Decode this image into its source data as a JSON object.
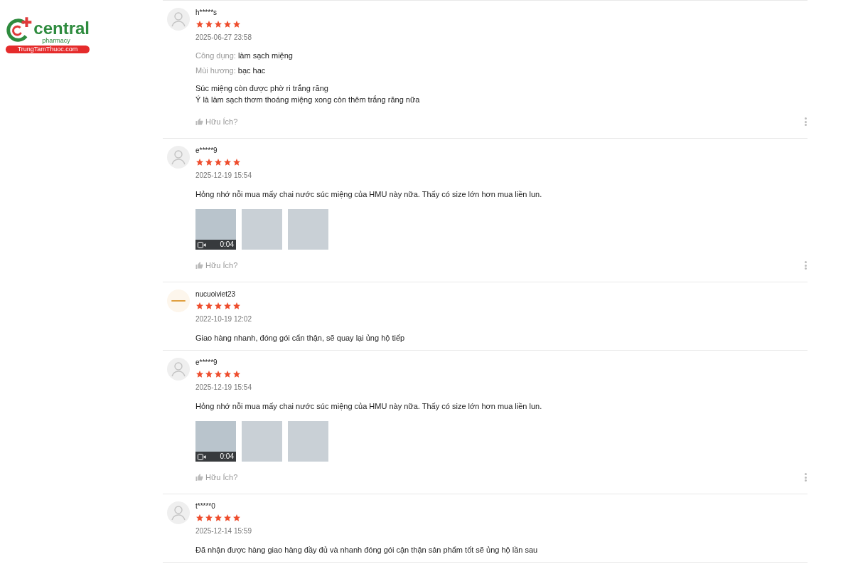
{
  "logo": {
    "name": "central",
    "tagline": "pharmacy",
    "site": "TrungTamThuoc.com"
  },
  "reviews": [
    {
      "avatar": {
        "kind": "default"
      },
      "username": "h*****s",
      "stars": 5,
      "date": "2025-06-27 23:58",
      "attributes": [
        {
          "label": "Công dụng:",
          "value": "làm sạch miệng"
        },
        {
          "label": "Mùi hương:",
          "value": "bạc hac"
        }
      ],
      "body": [
        "Súc miệng còn được phờ ri trắng răng",
        "Ý là làm sạch thơm thoáng miệng xong còn thêm trắng răng nữa"
      ],
      "helpful": "Hữu Ích?",
      "more_menu": true
    },
    {
      "avatar": {
        "kind": "default"
      },
      "username": "e*****9",
      "stars": 5,
      "date": "2025-12-19 15:54",
      "body": [
        "Hỏng nhớ nỗi mua mấy chai nước súc miệng của HMU này nữa. Thấy có size lớn hơn mua liền lun."
      ],
      "media": [
        {
          "kind": "video",
          "duration": "0:04"
        },
        {
          "kind": "photo"
        },
        {
          "kind": "photo"
        }
      ],
      "helpful": "Hữu Ích?",
      "more_menu": true
    },
    {
      "avatar": {
        "kind": "brand"
      },
      "username": "nucuoiviet23",
      "stars": 5,
      "date": "2022-10-19 12:02",
      "body": [
        "Giao hàng nhanh, đóng gói cẩn thận, sẽ quay lại ủng hộ tiếp"
      ],
      "more_menu": false
    },
    {
      "avatar": {
        "kind": "default"
      },
      "username": "e*****9",
      "stars": 5,
      "date": "2025-12-19 15:54",
      "body": [
        "Hỏng nhớ nỗi mua mấy chai nước súc miệng của HMU này nữa. Thấy có size lớn hơn mua liền lun."
      ],
      "media": [
        {
          "kind": "video",
          "duration": "0:04"
        },
        {
          "kind": "photo"
        },
        {
          "kind": "photo"
        }
      ],
      "helpful": "Hữu Ích?",
      "more_menu": true
    },
    {
      "avatar": {
        "kind": "default"
      },
      "username": "t*****0",
      "stars": 5,
      "date": "2025-12-14 15:59",
      "body": [
        "Đã nhận được hàng giao hàng đầy đủ và nhanh đóng gói cận thận sản phẩm tốt sẽ ủng hộ lần sau"
      ],
      "more_menu": false
    }
  ]
}
